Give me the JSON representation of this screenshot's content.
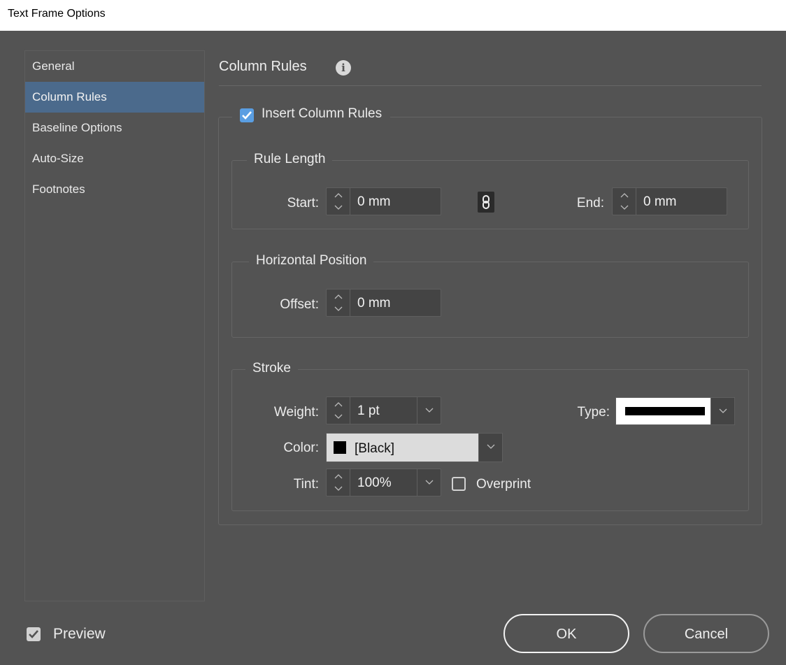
{
  "window": {
    "title": "Text Frame Options"
  },
  "sidebar": {
    "items": [
      {
        "label": "General",
        "active": false
      },
      {
        "label": "Column Rules",
        "active": true
      },
      {
        "label": "Baseline Options",
        "active": false
      },
      {
        "label": "Auto-Size",
        "active": false
      },
      {
        "label": "Footnotes",
        "active": false
      }
    ]
  },
  "panel": {
    "title": "Column Rules",
    "info_icon": "info-icon",
    "insert_column_rules": {
      "label": "Insert Column Rules",
      "checked": true
    },
    "rule_length": {
      "title": "Rule Length",
      "start_label": "Start:",
      "start_value": "0 mm",
      "link_icon": "chain-link-icon",
      "end_label": "End:",
      "end_value": "0 mm"
    },
    "horizontal_position": {
      "title": "Horizontal Position",
      "offset_label": "Offset:",
      "offset_value": "0 mm"
    },
    "stroke": {
      "title": "Stroke",
      "weight_label": "Weight:",
      "weight_value": "1 pt",
      "type_label": "Type:",
      "type_value": "solid-line",
      "color_label": "Color:",
      "color_value": "[Black]",
      "color_swatch": "#000000",
      "tint_label": "Tint:",
      "tint_value": "100%",
      "overprint_label": "Overprint",
      "overprint_checked": false
    }
  },
  "footer": {
    "preview_label": "Preview",
    "preview_checked": true,
    "ok_label": "OK",
    "cancel_label": "Cancel"
  },
  "colors": {
    "background": "#535353",
    "accent": "#4b6a8c",
    "checkbox_blue": "#5a9ee2"
  }
}
